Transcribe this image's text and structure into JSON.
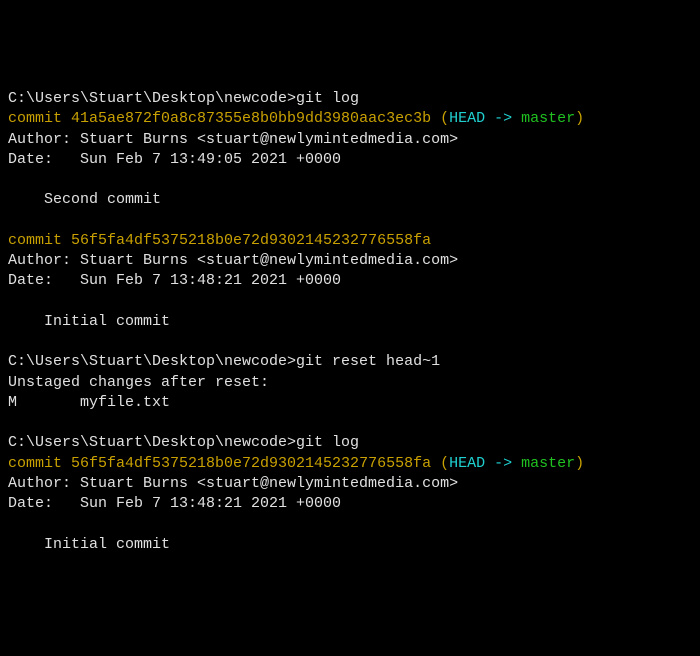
{
  "blocks": {
    "cmd1": {
      "prompt": "C:\\Users\\Stuart\\Desktop\\newcode>",
      "command": "git log"
    },
    "log1": {
      "commit1": {
        "label": "commit ",
        "hash": "41a5ae872f0a8c87355e8b0bb9dd3980aac3ec3b",
        "paren_open": " (",
        "head": "HEAD -> ",
        "branch": "master",
        "paren_close": ")",
        "author": "Author: Stuart Burns <stuart@newlymintedmedia.com>",
        "date": "Date:   Sun Feb 7 13:49:05 2021 +0000",
        "message": "    Second commit"
      },
      "commit2": {
        "label": "commit ",
        "hash": "56f5fa4df5375218b0e72d9302145232776558fa",
        "author": "Author: Stuart Burns <stuart@newlymintedmedia.com>",
        "date": "Date:   Sun Feb 7 13:48:21 2021 +0000",
        "message": "    Initial commit"
      }
    },
    "cmd2": {
      "prompt": "C:\\Users\\Stuart\\Desktop\\newcode>",
      "command": "git reset head~1"
    },
    "reset_output": {
      "line1": "Unstaged changes after reset:",
      "line2": "M       myfile.txt"
    },
    "cmd3": {
      "prompt": "C:\\Users\\Stuart\\Desktop\\newcode>",
      "command": "git log"
    },
    "log2": {
      "commit1": {
        "label": "commit ",
        "hash": "56f5fa4df5375218b0e72d9302145232776558fa",
        "paren_open": " (",
        "head": "HEAD -> ",
        "branch": "master",
        "paren_close": ")",
        "author": "Author: Stuart Burns <stuart@newlymintedmedia.com>",
        "date": "Date:   Sun Feb 7 13:48:21 2021 +0000",
        "message": "    Initial commit"
      }
    }
  }
}
